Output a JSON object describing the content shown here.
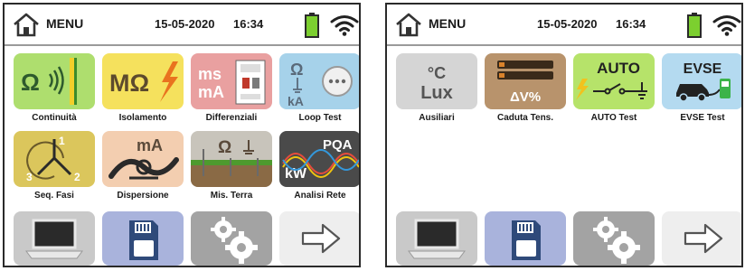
{
  "screens": [
    {
      "header": {
        "menu_label": "MENU",
        "date": "15-05-2020",
        "time": "16:34"
      },
      "tiles": [
        {
          "label": "Continuità",
          "icon": "continuity-icon",
          "symbol": "Ω",
          "color": "#aede6e"
        },
        {
          "label": "Isolamento",
          "icon": "insulation-icon",
          "symbol": "MΩ",
          "color": "#f5e15d"
        },
        {
          "label": "Differenziali",
          "icon": "rcd-icon",
          "symbol_top": "ms",
          "symbol_bottom": "mA",
          "color": "#e9a0a0"
        },
        {
          "label": "Loop Test",
          "icon": "loop-test-icon",
          "symbol_top": "Ω",
          "symbol_bottom": "kA",
          "color": "#a6d2ea"
        },
        {
          "label": "Seq. Fasi",
          "icon": "phase-sequence-icon",
          "phases": [
            "1",
            "2",
            "3"
          ],
          "color": "#dbc65c"
        },
        {
          "label": "Dispersione",
          "icon": "leakage-clamp-icon",
          "symbol": "mA",
          "color": "#f3ceb0"
        },
        {
          "label": "Mis. Terra",
          "icon": "earth-resistance-icon",
          "symbol": "Ω",
          "color": "#c8c4bb"
        },
        {
          "label": "Analisi Rete",
          "icon": "power-quality-icon",
          "symbol_top": "PQA",
          "symbol_bottom": "kW",
          "color": "#4a4a4a"
        }
      ]
    },
    {
      "header": {
        "menu_label": "MENU",
        "date": "15-05-2020",
        "time": "16:34"
      },
      "tiles": [
        {
          "label": "Ausiliari",
          "icon": "auxiliary-icon",
          "symbol_top": "°C",
          "symbol_bottom": "Lux",
          "color": "#d5d5d5"
        },
        {
          "label": "Caduta Tens.",
          "icon": "voltage-drop-icon",
          "symbol": "ΔV%",
          "color": "#b8936c"
        },
        {
          "label": "AUTO Test",
          "icon": "auto-test-icon",
          "symbol": "AUTO",
          "color": "#b6e36a"
        },
        {
          "label": "EVSE Test",
          "icon": "evse-test-icon",
          "symbol": "EVSE",
          "color": "#b4daf0"
        }
      ]
    }
  ],
  "nav_buttons": [
    {
      "icon": "pc-connection-icon",
      "color": "#c9c9c9"
    },
    {
      "icon": "memory-card-icon",
      "color": "#a9b3dc"
    },
    {
      "icon": "settings-gears-icon",
      "color": "#a3a3a3"
    },
    {
      "icon": "next-arrow-icon",
      "color": "#eeeeee"
    }
  ]
}
